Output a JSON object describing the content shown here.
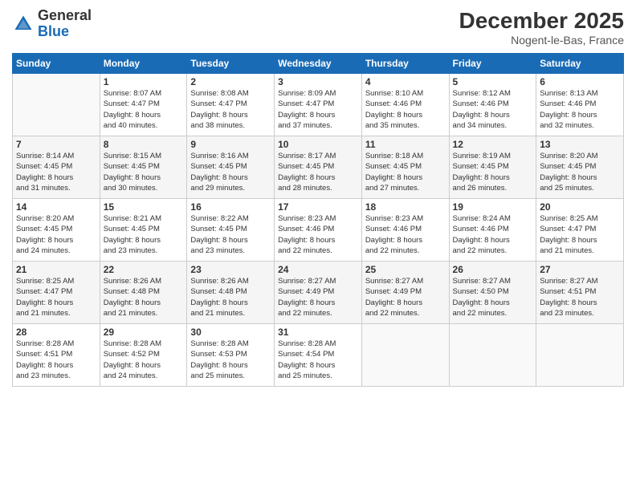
{
  "header": {
    "logo_general": "General",
    "logo_blue": "Blue",
    "month": "December 2025",
    "location": "Nogent-le-Bas, France"
  },
  "days_of_week": [
    "Sunday",
    "Monday",
    "Tuesday",
    "Wednesday",
    "Thursday",
    "Friday",
    "Saturday"
  ],
  "weeks": [
    [
      {
        "day": "",
        "info": ""
      },
      {
        "day": "1",
        "info": "Sunrise: 8:07 AM\nSunset: 4:47 PM\nDaylight: 8 hours\nand 40 minutes."
      },
      {
        "day": "2",
        "info": "Sunrise: 8:08 AM\nSunset: 4:47 PM\nDaylight: 8 hours\nand 38 minutes."
      },
      {
        "day": "3",
        "info": "Sunrise: 8:09 AM\nSunset: 4:47 PM\nDaylight: 8 hours\nand 37 minutes."
      },
      {
        "day": "4",
        "info": "Sunrise: 8:10 AM\nSunset: 4:46 PM\nDaylight: 8 hours\nand 35 minutes."
      },
      {
        "day": "5",
        "info": "Sunrise: 8:12 AM\nSunset: 4:46 PM\nDaylight: 8 hours\nand 34 minutes."
      },
      {
        "day": "6",
        "info": "Sunrise: 8:13 AM\nSunset: 4:46 PM\nDaylight: 8 hours\nand 32 minutes."
      }
    ],
    [
      {
        "day": "7",
        "info": "Sunrise: 8:14 AM\nSunset: 4:45 PM\nDaylight: 8 hours\nand 31 minutes."
      },
      {
        "day": "8",
        "info": "Sunrise: 8:15 AM\nSunset: 4:45 PM\nDaylight: 8 hours\nand 30 minutes."
      },
      {
        "day": "9",
        "info": "Sunrise: 8:16 AM\nSunset: 4:45 PM\nDaylight: 8 hours\nand 29 minutes."
      },
      {
        "day": "10",
        "info": "Sunrise: 8:17 AM\nSunset: 4:45 PM\nDaylight: 8 hours\nand 28 minutes."
      },
      {
        "day": "11",
        "info": "Sunrise: 8:18 AM\nSunset: 4:45 PM\nDaylight: 8 hours\nand 27 minutes."
      },
      {
        "day": "12",
        "info": "Sunrise: 8:19 AM\nSunset: 4:45 PM\nDaylight: 8 hours\nand 26 minutes."
      },
      {
        "day": "13",
        "info": "Sunrise: 8:20 AM\nSunset: 4:45 PM\nDaylight: 8 hours\nand 25 minutes."
      }
    ],
    [
      {
        "day": "14",
        "info": "Sunrise: 8:20 AM\nSunset: 4:45 PM\nDaylight: 8 hours\nand 24 minutes."
      },
      {
        "day": "15",
        "info": "Sunrise: 8:21 AM\nSunset: 4:45 PM\nDaylight: 8 hours\nand 23 minutes."
      },
      {
        "day": "16",
        "info": "Sunrise: 8:22 AM\nSunset: 4:45 PM\nDaylight: 8 hours\nand 23 minutes."
      },
      {
        "day": "17",
        "info": "Sunrise: 8:23 AM\nSunset: 4:46 PM\nDaylight: 8 hours\nand 22 minutes."
      },
      {
        "day": "18",
        "info": "Sunrise: 8:23 AM\nSunset: 4:46 PM\nDaylight: 8 hours\nand 22 minutes."
      },
      {
        "day": "19",
        "info": "Sunrise: 8:24 AM\nSunset: 4:46 PM\nDaylight: 8 hours\nand 22 minutes."
      },
      {
        "day": "20",
        "info": "Sunrise: 8:25 AM\nSunset: 4:47 PM\nDaylight: 8 hours\nand 21 minutes."
      }
    ],
    [
      {
        "day": "21",
        "info": "Sunrise: 8:25 AM\nSunset: 4:47 PM\nDaylight: 8 hours\nand 21 minutes."
      },
      {
        "day": "22",
        "info": "Sunrise: 8:26 AM\nSunset: 4:48 PM\nDaylight: 8 hours\nand 21 minutes."
      },
      {
        "day": "23",
        "info": "Sunrise: 8:26 AM\nSunset: 4:48 PM\nDaylight: 8 hours\nand 21 minutes."
      },
      {
        "day": "24",
        "info": "Sunrise: 8:27 AM\nSunset: 4:49 PM\nDaylight: 8 hours\nand 22 minutes."
      },
      {
        "day": "25",
        "info": "Sunrise: 8:27 AM\nSunset: 4:49 PM\nDaylight: 8 hours\nand 22 minutes."
      },
      {
        "day": "26",
        "info": "Sunrise: 8:27 AM\nSunset: 4:50 PM\nDaylight: 8 hours\nand 22 minutes."
      },
      {
        "day": "27",
        "info": "Sunrise: 8:27 AM\nSunset: 4:51 PM\nDaylight: 8 hours\nand 23 minutes."
      }
    ],
    [
      {
        "day": "28",
        "info": "Sunrise: 8:28 AM\nSunset: 4:51 PM\nDaylight: 8 hours\nand 23 minutes."
      },
      {
        "day": "29",
        "info": "Sunrise: 8:28 AM\nSunset: 4:52 PM\nDaylight: 8 hours\nand 24 minutes."
      },
      {
        "day": "30",
        "info": "Sunrise: 8:28 AM\nSunset: 4:53 PM\nDaylight: 8 hours\nand 25 minutes."
      },
      {
        "day": "31",
        "info": "Sunrise: 8:28 AM\nSunset: 4:54 PM\nDaylight: 8 hours\nand 25 minutes."
      },
      {
        "day": "",
        "info": ""
      },
      {
        "day": "",
        "info": ""
      },
      {
        "day": "",
        "info": ""
      }
    ]
  ]
}
